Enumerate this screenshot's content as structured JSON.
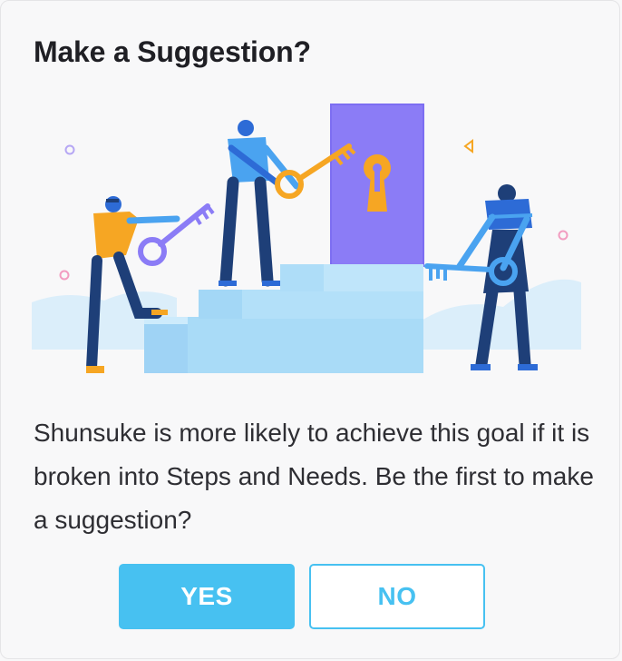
{
  "dialog": {
    "title": "Make a Suggestion?",
    "message": "Shunsuke is more likely to achieve this goal if it is broken into Steps and Needs. Be the first to make a suggestion?",
    "yes_label": "YES",
    "no_label": "NO"
  },
  "illustration": {
    "subject": "people-climbing-stairs-with-keys-to-door",
    "icons": [
      "key-icon",
      "keyhole-icon",
      "door-icon"
    ]
  },
  "colors": {
    "accent": "#47c1f1",
    "door": "#8b7cf6",
    "key_orange": "#f6a623",
    "stairs": "#a9dbf7"
  }
}
